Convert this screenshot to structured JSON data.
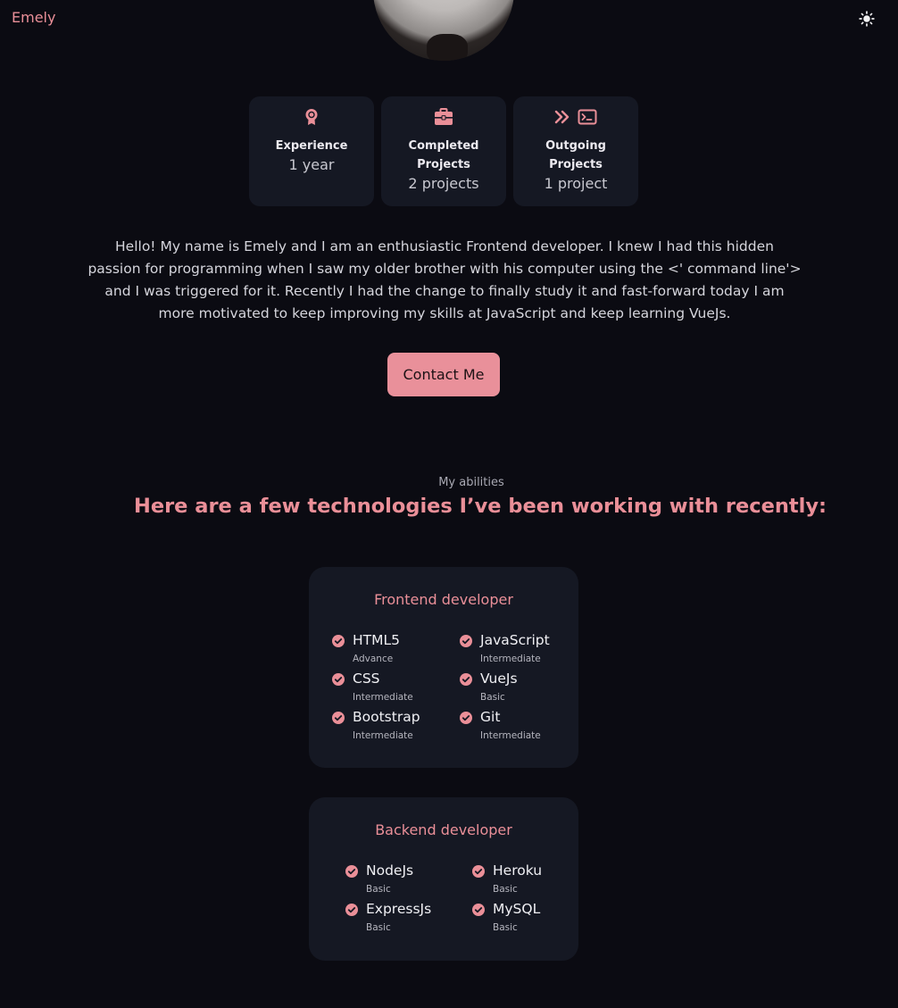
{
  "header": {
    "logo": "Emely",
    "theme_icon": "sun-icon"
  },
  "stats": [
    {
      "icon": "award-icon",
      "title": "Experience",
      "value": "1 year"
    },
    {
      "icon": "briefcase-icon",
      "title": "Completed Projects",
      "value": "2 projects"
    },
    {
      "icons": [
        "double-chevron-right-icon",
        "terminal-icon"
      ],
      "title": "Outgoing Projects",
      "value": "1 project"
    }
  ],
  "about": {
    "text": "Hello! My name is Emely and I am an enthusiastic Frontend developer. I knew I had this hidden passion for programming when I saw my older brother with his computer using the <' command line'> and I was triggered for it. Recently I had the change to finally study it and fast-forward today I am more motivated to keep improving my skills at JavaScript and keep learning VueJs."
  },
  "contact_button": "Contact Me",
  "skills_section": {
    "subtitle": "My abilities",
    "title": "Here are a few technologies I’ve been working with recently:"
  },
  "frontend": {
    "title": "Frontend developer",
    "skills": [
      {
        "name": "HTML5",
        "level": "Advance"
      },
      {
        "name": "JavaScript",
        "level": "Intermediate"
      },
      {
        "name": "CSS",
        "level": "Intermediate"
      },
      {
        "name": "VueJs",
        "level": "Basic"
      },
      {
        "name": "Bootstrap",
        "level": "Intermediate"
      },
      {
        "name": "Git",
        "level": "Intermediate"
      }
    ]
  },
  "backend": {
    "title": "Backend developer",
    "skills": [
      {
        "name": "NodeJs",
        "level": "Basic"
      },
      {
        "name": "Heroku",
        "level": "Basic"
      },
      {
        "name": "ExpressJs",
        "level": "Basic"
      },
      {
        "name": "MySQL",
        "level": "Basic"
      }
    ]
  },
  "colors": {
    "accent": "#ea8f98",
    "background": "#0b0b12",
    "card": "#151823"
  }
}
